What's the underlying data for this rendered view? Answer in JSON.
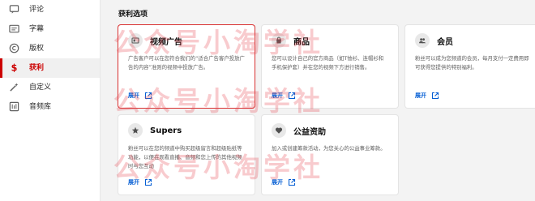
{
  "sidebar": {
    "items": [
      {
        "key": "comments",
        "label": "评论",
        "icon": "comment-icon",
        "active": false
      },
      {
        "key": "subtitles",
        "label": "字幕",
        "icon": "subtitles-icon",
        "active": false
      },
      {
        "key": "copyright",
        "label": "版权",
        "icon": "copyright-icon",
        "active": false
      },
      {
        "key": "monetization",
        "label": "获利",
        "icon": "dollar-icon",
        "active": true
      },
      {
        "key": "customization",
        "label": "自定义",
        "icon": "magic-wand-icon",
        "active": false
      },
      {
        "key": "audio",
        "label": "音频库",
        "icon": "audio-library-icon",
        "active": false
      }
    ]
  },
  "main": {
    "section_title": "获利选项",
    "expand_label": "展开",
    "cards": [
      {
        "key": "ads",
        "title": "视频广告",
        "icon": "ad-icon",
        "selected": true,
        "description": "广告客户可以在您符合我们的“适合广告客户投放广告的内容”准则的视频中投放广告。"
      },
      {
        "key": "merch",
        "title": "商品",
        "icon": "shopping-bag-icon",
        "selected": false,
        "description": "您可以设计自己的官方商品（如T恤衫、连帽衫和手机保护套）并在您的视频下方进行销售。"
      },
      {
        "key": "members",
        "title": "会员",
        "icon": "members-icon",
        "selected": false,
        "description": "粉丝可以成为您频道的会员，每月支付一定费用即可获得您提供的特别福利。"
      },
      {
        "key": "supers",
        "title": "Supers",
        "icon": "star-icon",
        "selected": false,
        "description": "粉丝可以在您的频道中购买超级留言和超级贴纸等功能，以便在观看直播、音频和您上传的其他视频时与您互动"
      },
      {
        "key": "giving",
        "title": "公益资助",
        "icon": "heart-icon",
        "selected": false,
        "description": "加入或创建筹款活动，为您关心的公益事业筹款。"
      }
    ]
  },
  "watermark": {
    "text": "公众号小淘学社"
  },
  "colors": {
    "accent": "#cc0000",
    "link": "#065fd4",
    "selected_border": "#d93030",
    "watermark": "#e64650"
  }
}
